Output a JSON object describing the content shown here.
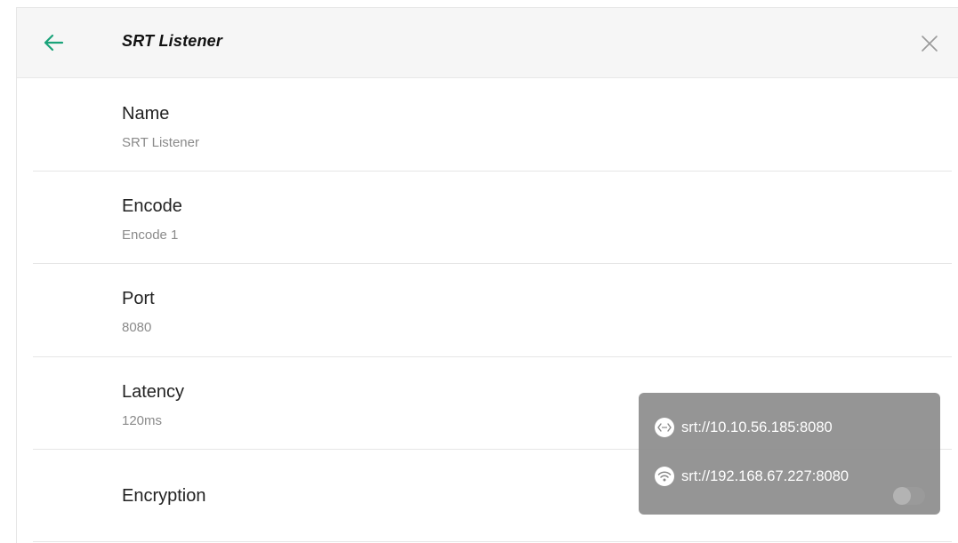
{
  "header": {
    "title": "SRT Listener",
    "back_icon": "arrow-left-icon",
    "close_icon": "close-icon",
    "accent_color": "#1aa37a"
  },
  "settings": [
    {
      "key": "name",
      "label": "Name",
      "value": "SRT Listener"
    },
    {
      "key": "encode",
      "label": "Encode",
      "value": "Encode 1"
    },
    {
      "key": "port",
      "label": "Port",
      "value": "8080"
    },
    {
      "key": "latency",
      "label": "Latency",
      "value": "120ms"
    },
    {
      "key": "encryption",
      "label": "Encryption"
    }
  ],
  "popup": {
    "items": [
      {
        "icon": "ethernet-icon",
        "url": "srt://10.10.56.185:8080"
      },
      {
        "icon": "wifi-icon",
        "url": "srt://192.168.67.227:8080"
      }
    ]
  },
  "encryption_toggle": {
    "enabled": false
  }
}
